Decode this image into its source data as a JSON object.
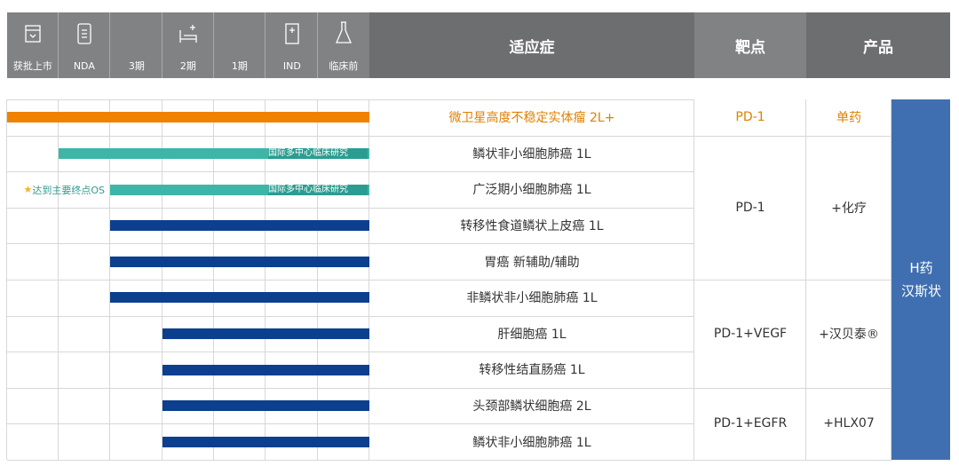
{
  "header": {
    "product": "产品",
    "target": "靶点",
    "indication": "适应症",
    "stages": [
      "临床前",
      "IND",
      "1期",
      "2期",
      "3期",
      "NDA",
      "获批上市"
    ]
  },
  "side_label": [
    "H药",
    "汉斯状"
  ],
  "groups": [
    {
      "name": "单药",
      "target": "PD-1",
      "highlight": true
    },
    {
      "name": "+化疗",
      "target": "PD-1"
    },
    {
      "name": "+汉贝泰®",
      "target": "PD-1+VEGF"
    },
    {
      "name": "+HLX07",
      "target": "PD-1+EGFR"
    }
  ],
  "rows": [
    {
      "indication": "微卫星高度不稳定实体瘤 2L+",
      "highlight": true
    },
    {
      "indication": "鳞状非小细胞肺癌 1L",
      "bar_label": "国际多中心临床研究"
    },
    {
      "indication": "广泛期小细胞肺癌 1L",
      "bar_label": "国际多中心临床研究",
      "note": "达到主要终点OS"
    },
    {
      "indication": "转移性食道鳞状上皮癌 1L"
    },
    {
      "indication": "胃癌 新辅助/辅助"
    },
    {
      "indication": "非鳞状非小细胞肺癌 1L"
    },
    {
      "indication": "肝细胞癌 1L"
    },
    {
      "indication": "转移性结直肠癌 1L"
    },
    {
      "indication": "头颈部鳞状细胞癌 2L"
    },
    {
      "indication": "鳞状非小细胞肺癌 1L"
    }
  ],
  "chart_data": {
    "type": "table",
    "stages": [
      "临床前",
      "IND",
      "1期",
      "2期",
      "3期",
      "NDA",
      "获批上市"
    ],
    "series": [
      {
        "indication": "微卫星高度不稳定实体瘤 2L+",
        "stage_reached": 7,
        "color": "#f08200"
      },
      {
        "indication": "鳞状非小细胞肺癌 1L",
        "stage_reached": 6,
        "color": "#3db6a7"
      },
      {
        "indication": "广泛期小细胞肺癌 1L",
        "stage_reached": 5,
        "color": "#3db6a7"
      },
      {
        "indication": "转移性食道鳞状上皮癌 1L",
        "stage_reached": 5,
        "color": "#0c3f8e"
      },
      {
        "indication": "胃癌 新辅助/辅助",
        "stage_reached": 5,
        "color": "#0c3f8e"
      },
      {
        "indication": "非鳞状非小细胞肺癌 1L",
        "stage_reached": 5,
        "color": "#0c3f8e"
      },
      {
        "indication": "肝细胞癌 1L",
        "stage_reached": 4,
        "color": "#0c3f8e"
      },
      {
        "indication": "转移性结直肠癌 1L",
        "stage_reached": 4,
        "color": "#0c3f8e"
      },
      {
        "indication": "头颈部鳞状细胞癌 2L",
        "stage_reached": 4,
        "color": "#0c3f8e"
      },
      {
        "indication": "鳞状非小细胞肺癌 1L",
        "stage_reached": 4,
        "color": "#0c3f8e"
      }
    ]
  }
}
